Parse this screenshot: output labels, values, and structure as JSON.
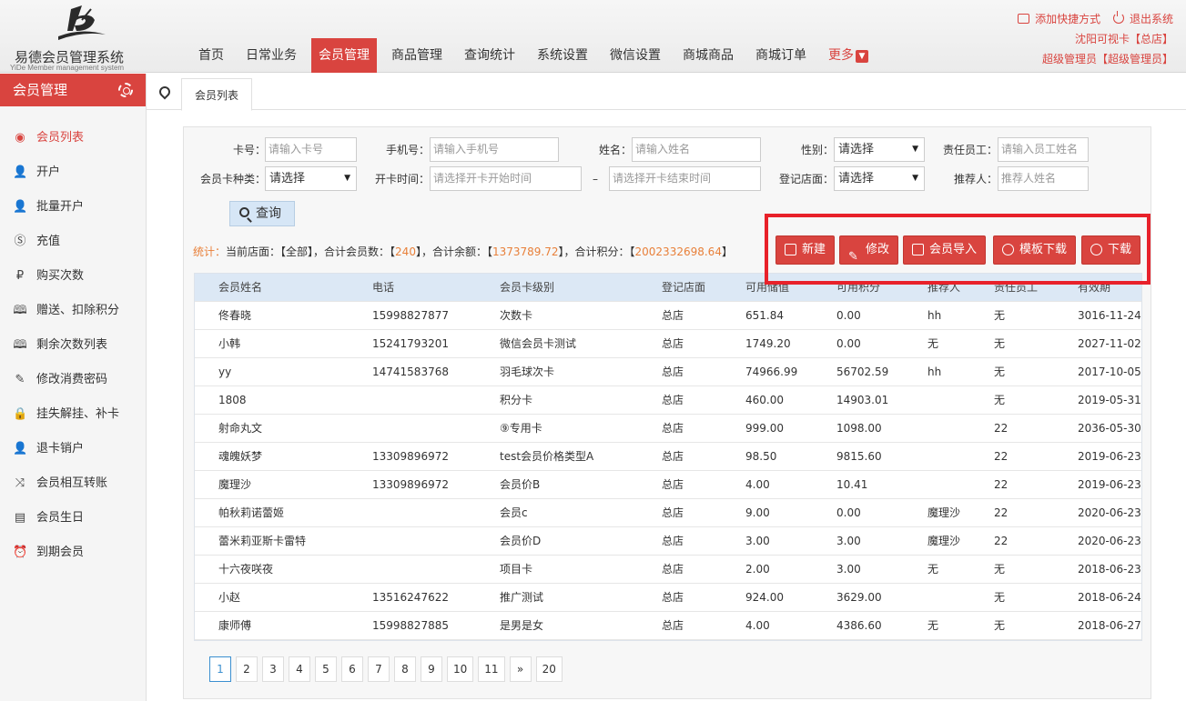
{
  "app": {
    "title": "易德会员管理系统",
    "subtitle": "YiDe Member management system"
  },
  "nav": {
    "items": [
      "首页",
      "日常业务",
      "会员管理",
      "商品管理",
      "查询统计",
      "系统设置",
      "微信设置",
      "商城商品",
      "商城订单"
    ],
    "active_index": 2,
    "more_label": "更多"
  },
  "top_right": {
    "shortcut": "添加快捷方式",
    "logout": "退出系统",
    "store": "沈阳可视卡【总店】",
    "user": "超级管理员【超级管理员】"
  },
  "sidebar": {
    "header": "会员管理",
    "items": [
      {
        "label": "会员列表",
        "icon": "user-circle-icon",
        "glyph": "◉"
      },
      {
        "label": "开户",
        "icon": "user-icon",
        "glyph": "👤"
      },
      {
        "label": "批量开户",
        "icon": "user-icon",
        "glyph": "👤"
      },
      {
        "label": "充值",
        "icon": "coin-icon",
        "glyph": "Ⓢ"
      },
      {
        "label": "购买次数",
        "icon": "ruble-icon",
        "glyph": "₽"
      },
      {
        "label": "赠送、扣除积分",
        "icon": "book-icon",
        "glyph": "🕮"
      },
      {
        "label": "剩余次数列表",
        "icon": "book-icon",
        "glyph": "🕮"
      },
      {
        "label": "修改消费密码",
        "icon": "pencil-icon",
        "glyph": "✎"
      },
      {
        "label": "挂失解挂、补卡",
        "icon": "lock-icon",
        "glyph": "🔒"
      },
      {
        "label": "退卡销户",
        "icon": "user-icon",
        "glyph": "👤"
      },
      {
        "label": "会员相互转账",
        "icon": "shuffle-icon",
        "glyph": "⤨"
      },
      {
        "label": "会员生日",
        "icon": "cake-icon",
        "glyph": "▤"
      },
      {
        "label": "到期会员",
        "icon": "alarm-icon",
        "glyph": "⏰"
      }
    ],
    "active_index": 0
  },
  "tabs": {
    "current": "会员列表"
  },
  "filters": {
    "card_no": {
      "label": "卡号：",
      "placeholder": "请输入卡号"
    },
    "phone": {
      "label": "手机号：",
      "placeholder": "请输入手机号"
    },
    "name": {
      "label": "姓名：",
      "placeholder": "请输入姓名"
    },
    "gender": {
      "label": "性别：",
      "value": "请选择"
    },
    "staff": {
      "label": "责任员工：",
      "placeholder": "请输入员工姓名"
    },
    "card_type": {
      "label": "会员卡种类：",
      "value": "请选择"
    },
    "open_time": {
      "label": "开卡时间：",
      "start_placeholder": "请选择开卡开始时间",
      "end_placeholder": "请选择开卡结束时间",
      "separator": "–"
    },
    "store": {
      "label": "登记店面：",
      "value": "请选择"
    },
    "referrer": {
      "label": "推荐人：",
      "placeholder": "推荐人姓名"
    },
    "query_label": "查询"
  },
  "stats": {
    "label": "统计：",
    "store_prefix": "当前店面：【全部】，",
    "members_prefix": "合计会员数：【",
    "members": "240",
    "balance_prefix": "】，合计余额：【",
    "balance": "1373789.72",
    "points_prefix": "】，合计积分：【",
    "points": "2002332698.64",
    "suffix": "】"
  },
  "actions": {
    "new": "新建",
    "edit": "修改",
    "import": "会员导入",
    "template": "模板下载",
    "download": "下载"
  },
  "table": {
    "columns": [
      "会员姓名",
      "电话",
      "会员卡级别",
      "登记店面",
      "可用储值",
      "可用积分",
      "推荐人",
      "责任员工",
      "有效期"
    ],
    "rows": [
      [
        "佟春晓",
        "15998827877",
        "次数卡",
        "总店",
        "651.84",
        "0.00",
        "hh",
        "无",
        "3016-11-24"
      ],
      [
        "小韩",
        "15241793201",
        "微信会员卡测试",
        "总店",
        "1749.20",
        "0.00",
        "无",
        "无",
        "2027-11-02"
      ],
      [
        "yy",
        "14741583768",
        "羽毛球次卡",
        "总店",
        "74966.99",
        "56702.59",
        "hh",
        "无",
        "2017-10-05"
      ],
      [
        "1808",
        "",
        "积分卡",
        "总店",
        "460.00",
        "14903.01",
        "",
        "无",
        "2019-05-31"
      ],
      [
        "射命丸文",
        "",
        "⑨专用卡",
        "总店",
        "999.00",
        "1098.00",
        "",
        "22",
        "2036-05-30"
      ],
      [
        "魂魄妖梦",
        "13309896972",
        "test会员价格类型A",
        "总店",
        "98.50",
        "9815.60",
        "",
        "22",
        "2019-06-23"
      ],
      [
        "魔理沙",
        "13309896972",
        "会员价B",
        "总店",
        "4.00",
        "10.41",
        "",
        "22",
        "2019-06-23"
      ],
      [
        "帕秋莉诺蕾姬",
        "",
        "会员c",
        "总店",
        "9.00",
        "0.00",
        "魔理沙",
        "22",
        "2020-06-23"
      ],
      [
        "蕾米莉亚斯卡雷特",
        "",
        "会员价D",
        "总店",
        "3.00",
        "3.00",
        "魔理沙",
        "22",
        "2020-06-23"
      ],
      [
        "十六夜咲夜",
        "",
        "项目卡",
        "总店",
        "2.00",
        "3.00",
        "无",
        "无",
        "2018-06-23"
      ],
      [
        "小赵",
        "13516247622",
        "推广测试",
        "总店",
        "924.00",
        "3629.00",
        "",
        "无",
        "2018-06-24"
      ],
      [
        "康师傅",
        "15998827885",
        "是男是女",
        "总店",
        "4.00",
        "4386.60",
        "无",
        "无",
        "2018-06-27"
      ]
    ]
  },
  "pagination": {
    "pages": [
      "1",
      "2",
      "3",
      "4",
      "5",
      "6",
      "7",
      "8",
      "9",
      "10",
      "11",
      "»",
      "20"
    ],
    "active": "1"
  },
  "colors": {
    "accent": "#d9443f",
    "highlight_box": "#e8212a",
    "stat_number": "#e8803a"
  }
}
